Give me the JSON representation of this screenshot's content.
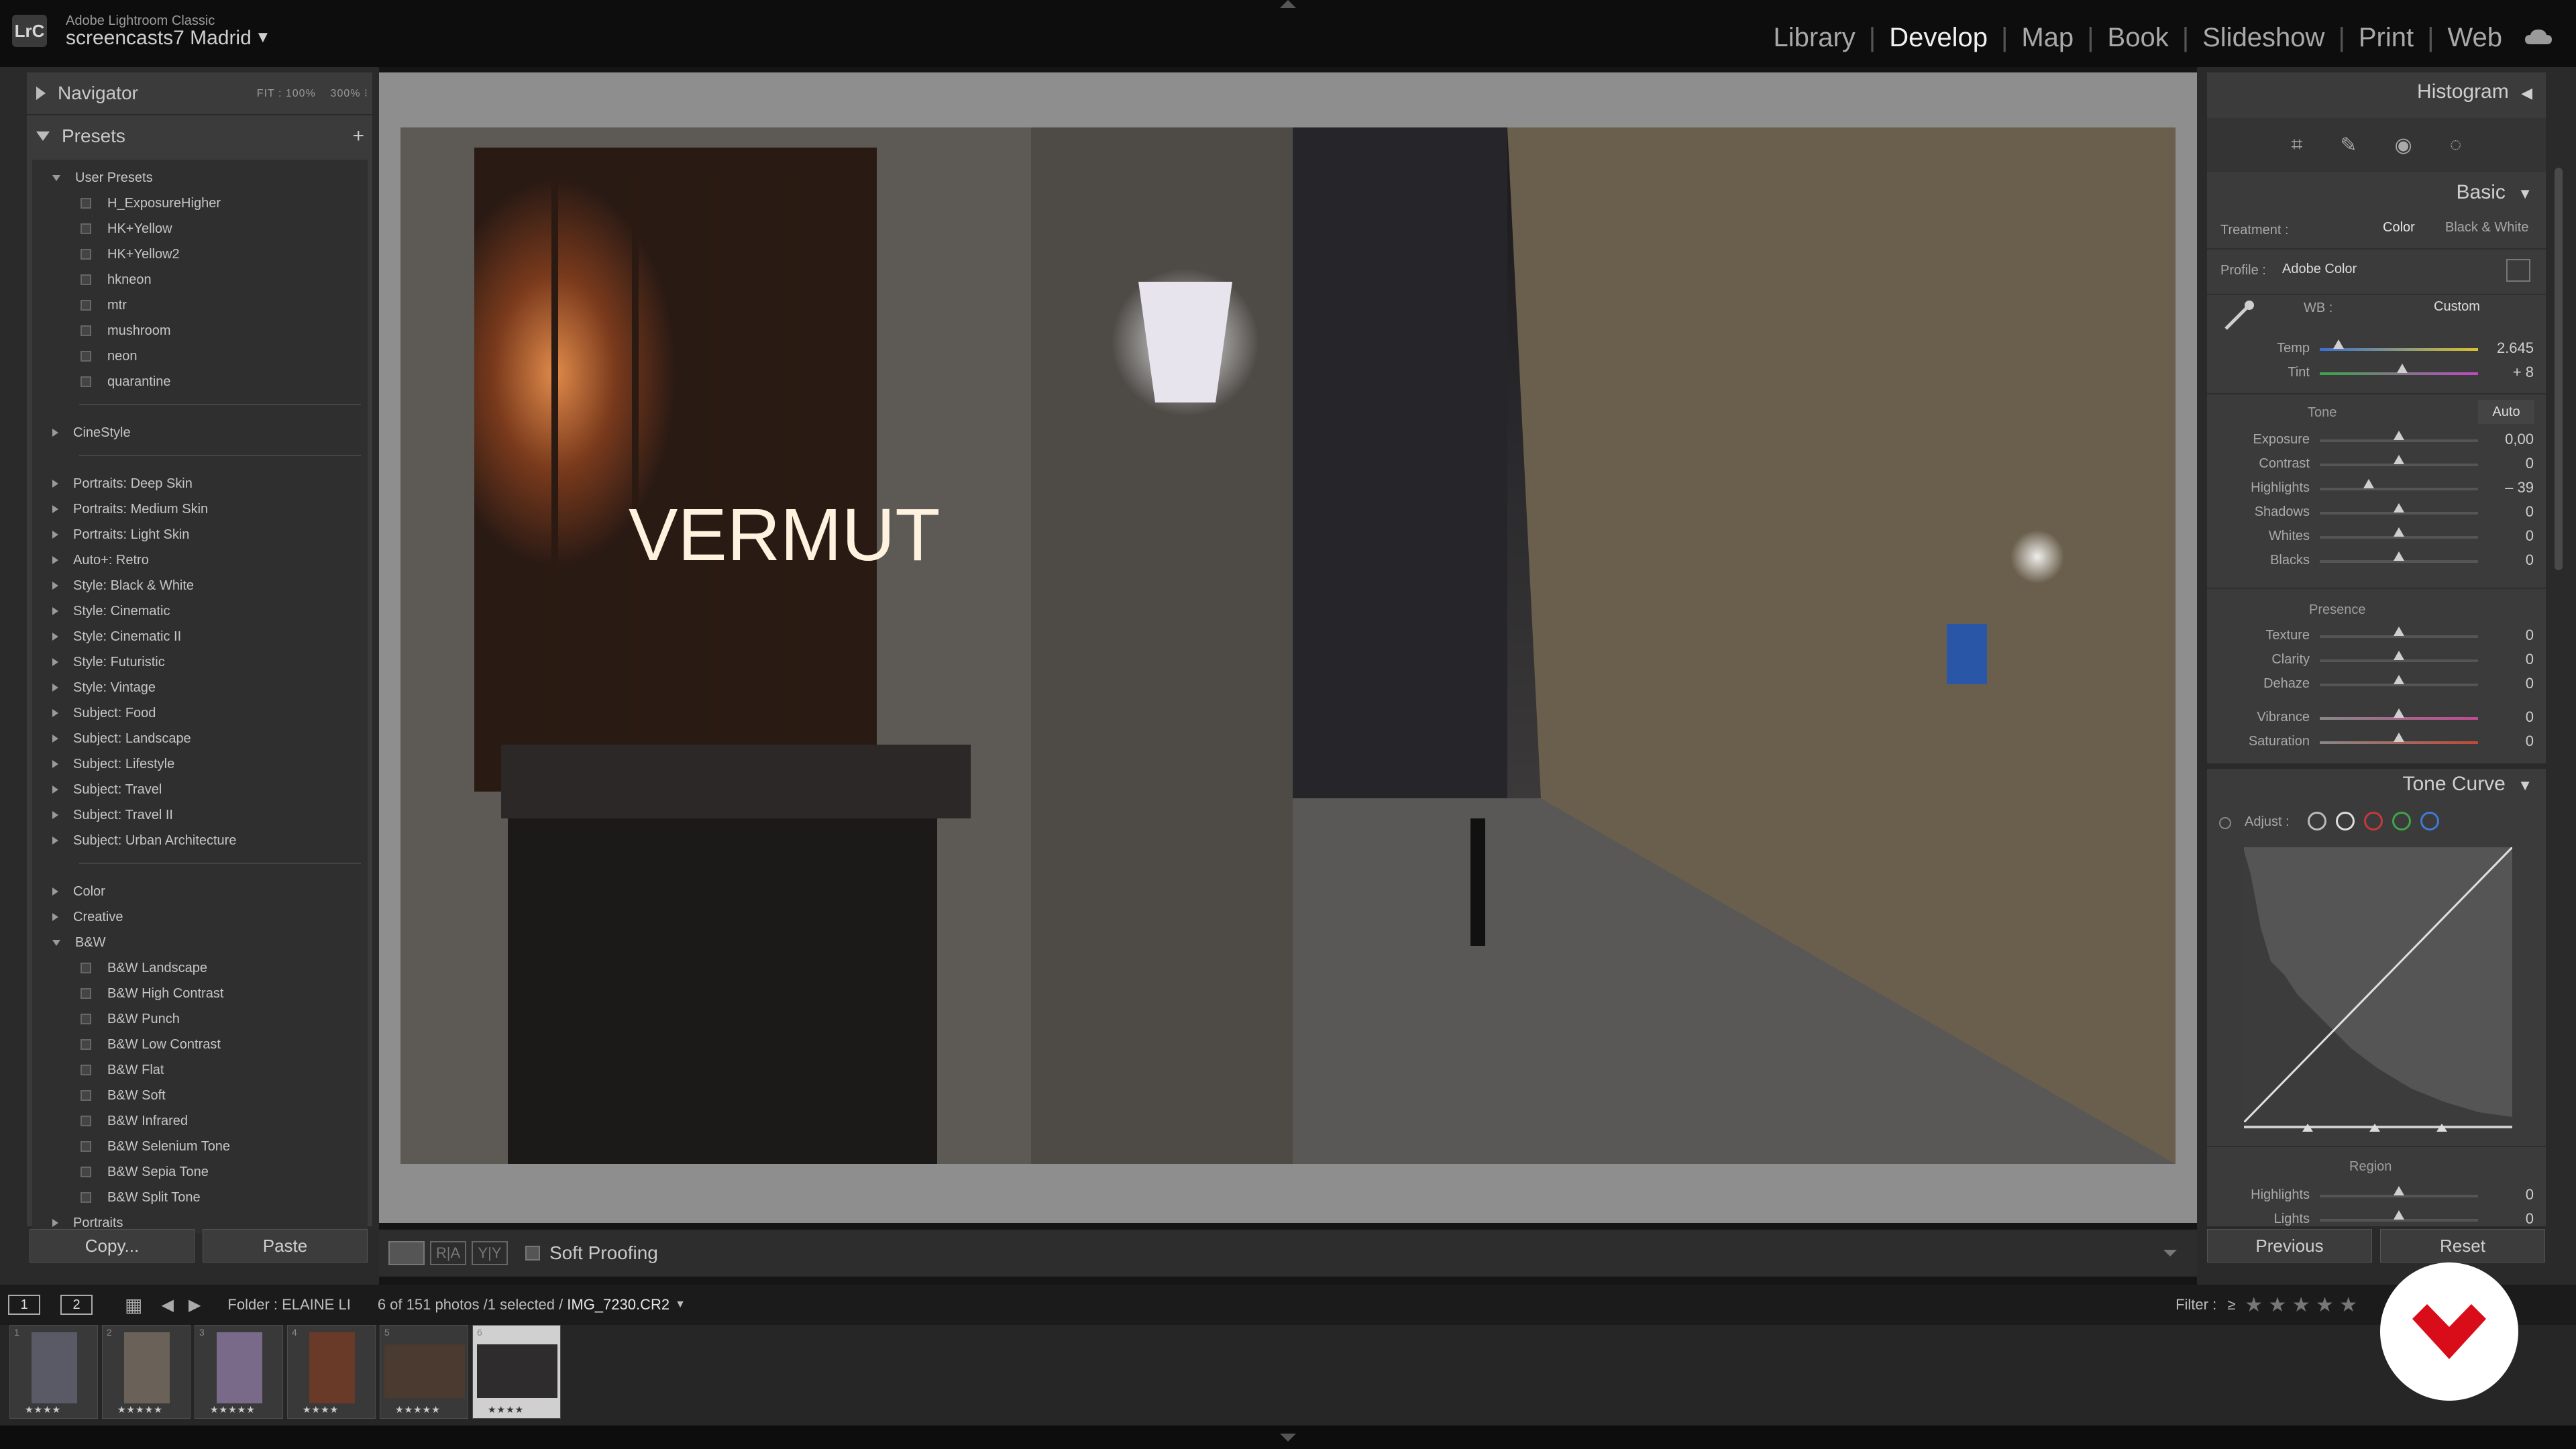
{
  "app": {
    "badge": "LrC",
    "name": "Adobe Lightroom Classic",
    "catalog": "screencasts7 Madrid",
    "caret": "▼"
  },
  "modules": [
    "Library",
    "Develop",
    "Map",
    "Book",
    "Slideshow",
    "Print",
    "Web"
  ],
  "active_module": "Develop",
  "left": {
    "navigator": {
      "title": "Navigator",
      "zoom_options": [
        "FIT",
        "100%",
        "300%"
      ]
    },
    "presets": {
      "title": "Presets",
      "add": "+",
      "items": [
        {
          "label": "User Presets",
          "type": "group-open"
        },
        {
          "label": "H_ExposureHigher",
          "type": "preset"
        },
        {
          "label": "HK+Yellow",
          "type": "preset"
        },
        {
          "label": "HK+Yellow2",
          "type": "preset"
        },
        {
          "label": "hkneon",
          "type": "preset"
        },
        {
          "label": "mtr",
          "type": "preset"
        },
        {
          "label": "mushroom",
          "type": "preset"
        },
        {
          "label": "neon",
          "type": "preset"
        },
        {
          "label": "quarantine",
          "type": "preset"
        },
        {
          "label": "",
          "type": "sep"
        },
        {
          "label": "CineStyle",
          "type": "group"
        },
        {
          "label": "",
          "type": "sep"
        },
        {
          "label": "Portraits: Deep Skin",
          "type": "group"
        },
        {
          "label": "Portraits: Medium Skin",
          "type": "group"
        },
        {
          "label": "Portraits: Light Skin",
          "type": "group"
        },
        {
          "label": "Auto+: Retro",
          "type": "group"
        },
        {
          "label": "Style: Black & White",
          "type": "group"
        },
        {
          "label": "Style: Cinematic",
          "type": "group"
        },
        {
          "label": "Style: Cinematic II",
          "type": "group"
        },
        {
          "label": "Style: Futuristic",
          "type": "group"
        },
        {
          "label": "Style: Vintage",
          "type": "group"
        },
        {
          "label": "Subject: Food",
          "type": "group"
        },
        {
          "label": "Subject: Landscape",
          "type": "group"
        },
        {
          "label": "Subject: Lifestyle",
          "type": "group"
        },
        {
          "label": "Subject: Travel",
          "type": "group"
        },
        {
          "label": "Subject: Travel II",
          "type": "group"
        },
        {
          "label": "Subject: Urban Architecture",
          "type": "group"
        },
        {
          "label": "",
          "type": "sep"
        },
        {
          "label": "Color",
          "type": "group"
        },
        {
          "label": "Creative",
          "type": "group"
        },
        {
          "label": "B&W",
          "type": "group-open"
        },
        {
          "label": "B&W Landscape",
          "type": "preset"
        },
        {
          "label": "B&W High Contrast",
          "type": "preset"
        },
        {
          "label": "B&W Punch",
          "type": "preset"
        },
        {
          "label": "B&W Low Contrast",
          "type": "preset"
        },
        {
          "label": "B&W Flat",
          "type": "preset"
        },
        {
          "label": "B&W Soft",
          "type": "preset"
        },
        {
          "label": "B&W Infrared",
          "type": "preset"
        },
        {
          "label": "B&W Selenium Tone",
          "type": "preset"
        },
        {
          "label": "B&W Sepia Tone",
          "type": "preset"
        },
        {
          "label": "B&W Split Tone",
          "type": "preset"
        },
        {
          "label": "Portraits",
          "type": "group"
        }
      ]
    },
    "copy_label": "Copy...",
    "paste_label": "Paste"
  },
  "center": {
    "photo_text": "VERMUT",
    "view_modes": [
      "R|A",
      "Y|Y"
    ],
    "soft_proofing": "Soft Proofing"
  },
  "right": {
    "histogram": "Histogram",
    "basic": "Basic",
    "treatment_label": "Treatment :",
    "treatment_options": [
      "Color",
      "Black & White"
    ],
    "profile_label": "Profile :",
    "profile_value": "Adobe Color",
    "wb_label": "WB :",
    "wb_value": "Custom",
    "wb_sliders": [
      {
        "label": "Temp",
        "value": "2.645",
        "pos": 0.12
      },
      {
        "label": "Tint",
        "value": "+ 8",
        "pos": 0.52
      }
    ],
    "tone_label": "Tone",
    "auto_label": "Auto",
    "tone_sliders": [
      {
        "label": "Exposure",
        "value": "0,00",
        "pos": 0.5
      },
      {
        "label": "Contrast",
        "value": "0",
        "pos": 0.5
      },
      {
        "label": "Highlights",
        "value": "– 39",
        "pos": 0.31
      },
      {
        "label": "Shadows",
        "value": "0",
        "pos": 0.5
      },
      {
        "label": "Whites",
        "value": "0",
        "pos": 0.5
      },
      {
        "label": "Blacks",
        "value": "0",
        "pos": 0.5
      }
    ],
    "presence_label": "Presence",
    "presence_sliders": [
      {
        "label": "Texture",
        "value": "0",
        "pos": 0.5
      },
      {
        "label": "Clarity",
        "value": "0",
        "pos": 0.5
      },
      {
        "label": "Dehaze",
        "value": "0",
        "pos": 0.5
      },
      {
        "label": "Vibrance",
        "value": "0",
        "pos": 0.5
      },
      {
        "label": "Saturation",
        "value": "0",
        "pos": 0.5
      }
    ],
    "tone_curve": "Tone Curve",
    "adjust_label": "Adjust :",
    "region_label": "Region",
    "region_sliders": [
      {
        "label": "Highlights",
        "value": "0",
        "pos": 0.5
      },
      {
        "label": "Lights",
        "value": "0",
        "pos": 0.5
      }
    ],
    "previous_label": "Previous",
    "reset_label": "Reset"
  },
  "filmbar": {
    "monitor1": "1",
    "monitor2": "2",
    "folder": "Folder : ELAINE LI",
    "count": "6 of 151 photos /1 selected /",
    "filename": "IMG_7230.CR2",
    "filter_label": "Filter :",
    "filter_op": "≥",
    "filter_stars": "★ ★ ★ ★ ★",
    "right_glyph": "R"
  },
  "filmstrip": [
    {
      "num": "1",
      "stars": "★★★★"
    },
    {
      "num": "2",
      "stars": "★★★★★"
    },
    {
      "num": "3",
      "stars": "★★★★★"
    },
    {
      "num": "4",
      "stars": "★★★★"
    },
    {
      "num": "5",
      "stars": "★★★★★"
    },
    {
      "num": "6",
      "stars": "★★★★",
      "selected": true
    }
  ],
  "colors": {
    "accent_red": "#d90c1a",
    "panel": "#3b3b3b",
    "canvas": "#8e8e8e"
  }
}
